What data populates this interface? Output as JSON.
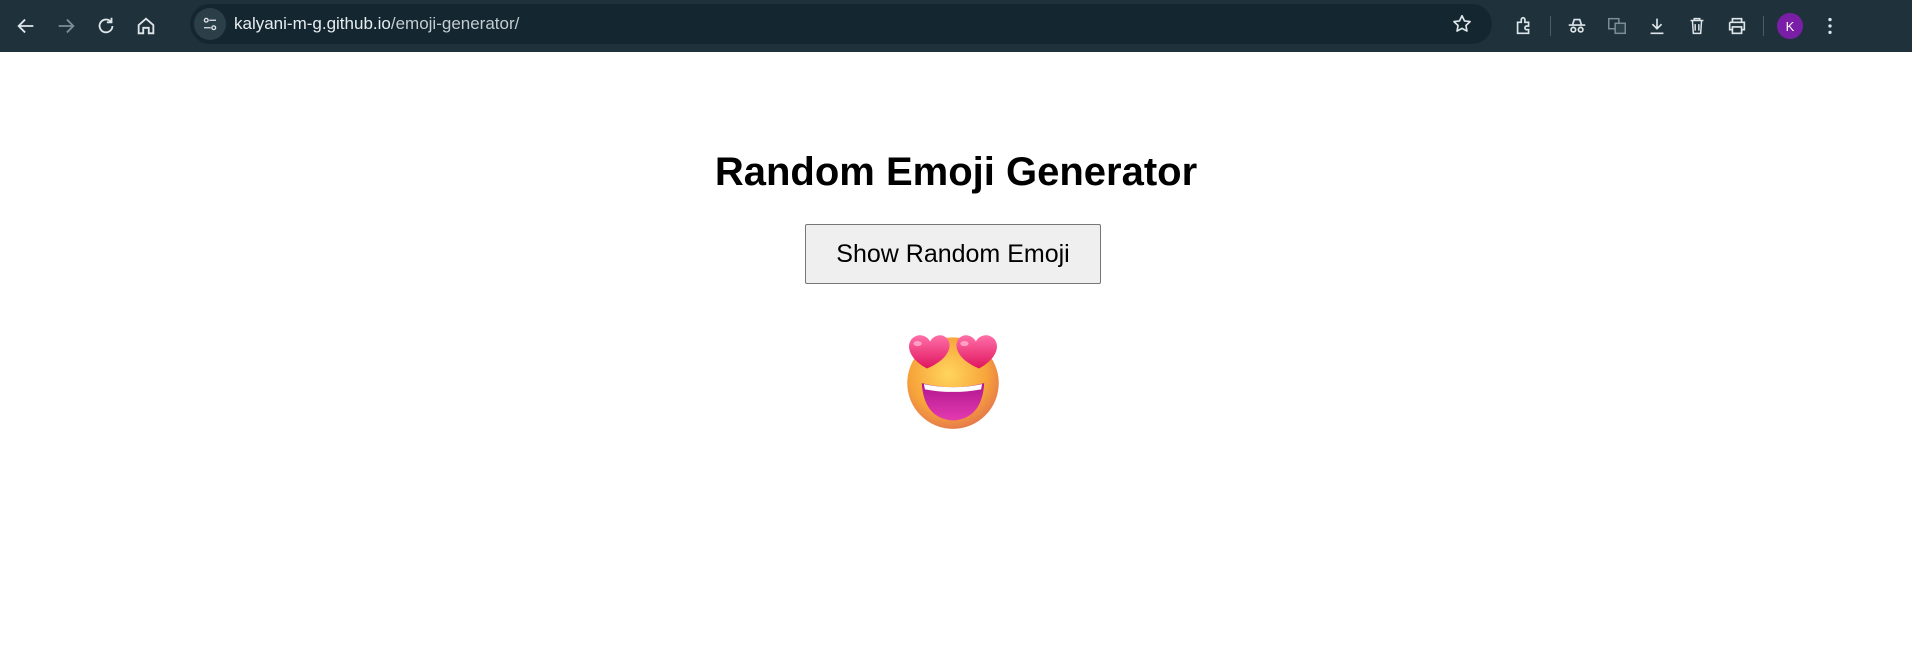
{
  "browser": {
    "url_host": "kalyani-m-g.github.io",
    "url_path": "/emoji-generator/",
    "profile_initial": "K",
    "icons": [
      "back-icon",
      "forward-icon",
      "reload-icon",
      "home-icon",
      "site-settings-icon",
      "bookmark-star-icon",
      "extensions-icon",
      "incognito-icon",
      "translate-icon",
      "download-icon",
      "delete-icon",
      "print-icon",
      "more-menu-icon"
    ]
  },
  "page": {
    "title": "Random Emoji Generator",
    "button_label": "Show Random Emoji",
    "current_emoji": "smiling-face-with-heart-eyes"
  },
  "colors": {
    "toolbar": "#1f323c",
    "omnibox": "#14262f",
    "avatar": "#7a1ea8"
  }
}
